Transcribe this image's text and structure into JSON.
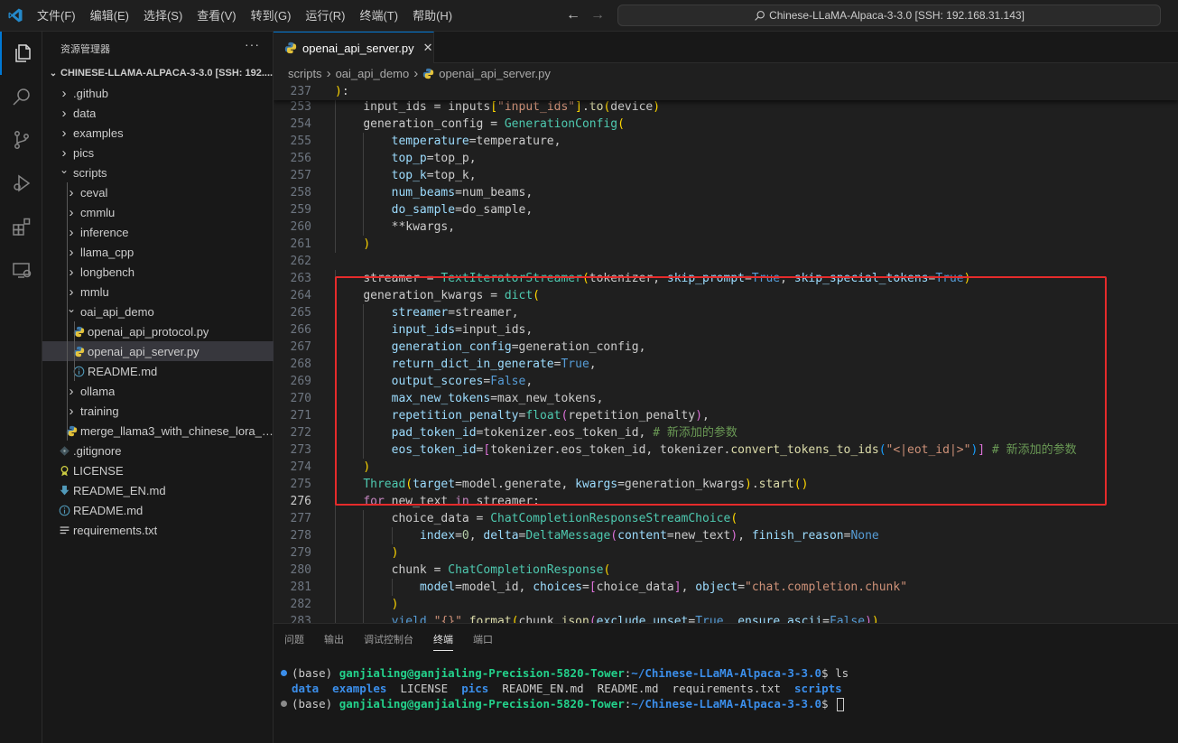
{
  "titlebar": {
    "menus": [
      "文件(F)",
      "编辑(E)",
      "选择(S)",
      "查看(V)",
      "转到(G)",
      "运行(R)",
      "终端(T)",
      "帮助(H)"
    ],
    "command_center": "Chinese-LLaMA-Alpaca-3-3.0 [SSH: 192.168.31.143]"
  },
  "sidebar": {
    "title": "资源管理器",
    "more": "···",
    "root": "CHINESE-LLAMA-ALPACA-3-3.0 [SSH: 192....",
    "items": [
      {
        "label": ".github",
        "type": "folder",
        "depth": 0,
        "expanded": false
      },
      {
        "label": "data",
        "type": "folder",
        "depth": 0,
        "expanded": false
      },
      {
        "label": "examples",
        "type": "folder",
        "depth": 0,
        "expanded": false
      },
      {
        "label": "pics",
        "type": "folder",
        "depth": 0,
        "expanded": false
      },
      {
        "label": "scripts",
        "type": "folder",
        "depth": 0,
        "expanded": true
      },
      {
        "label": "ceval",
        "type": "folder",
        "depth": 1,
        "expanded": false
      },
      {
        "label": "cmmlu",
        "type": "folder",
        "depth": 1,
        "expanded": false
      },
      {
        "label": "inference",
        "type": "folder",
        "depth": 1,
        "expanded": false
      },
      {
        "label": "llama_cpp",
        "type": "folder",
        "depth": 1,
        "expanded": false
      },
      {
        "label": "longbench",
        "type": "folder",
        "depth": 1,
        "expanded": false
      },
      {
        "label": "mmlu",
        "type": "folder",
        "depth": 1,
        "expanded": false
      },
      {
        "label": "oai_api_demo",
        "type": "folder",
        "depth": 1,
        "expanded": true
      },
      {
        "label": "openai_api_protocol.py",
        "type": "python",
        "depth": 2
      },
      {
        "label": "openai_api_server.py",
        "type": "python",
        "depth": 2,
        "selected": true
      },
      {
        "label": "README.md",
        "type": "info",
        "depth": 2
      },
      {
        "label": "ollama",
        "type": "folder",
        "depth": 1,
        "expanded": false
      },
      {
        "label": "training",
        "type": "folder",
        "depth": 1,
        "expanded": false
      },
      {
        "label": "merge_llama3_with_chinese_lora_lo...",
        "type": "python",
        "depth": 1
      },
      {
        "label": ".gitignore",
        "type": "git",
        "depth": 0
      },
      {
        "label": "LICENSE",
        "type": "license",
        "depth": 0
      },
      {
        "label": "README_EN.md",
        "type": "download",
        "depth": 0
      },
      {
        "label": "README.md",
        "type": "info",
        "depth": 0
      },
      {
        "label": "requirements.txt",
        "type": "text",
        "depth": 0
      }
    ]
  },
  "editor": {
    "tab_label": "openai_api_server.py",
    "tab_close": "✕",
    "breadcrumb": [
      "scripts",
      "oai_api_demo",
      "openai_api_server.py"
    ],
    "current_line": "276",
    "sticky_line": {
      "num": "237",
      "tokens": [
        [
          "b",
          ")"
        ],
        [
          "p",
          ":"
        ]
      ]
    },
    "lines": [
      {
        "num": "253",
        "indent": 1,
        "tokens": [
          [
            "p",
            "input_ids = inputs"
          ],
          [
            "b",
            "["
          ],
          [
            "s",
            "\"input_ids\""
          ],
          [
            "b",
            "]"
          ],
          [
            "p",
            "."
          ],
          [
            "f",
            "to"
          ],
          [
            "b",
            "("
          ],
          [
            "p",
            "device"
          ],
          [
            "b",
            ")"
          ]
        ]
      },
      {
        "num": "254",
        "indent": 1,
        "tokens": [
          [
            "p",
            "generation_config = "
          ],
          [
            "c",
            "GenerationConfig"
          ],
          [
            "b",
            "("
          ]
        ]
      },
      {
        "num": "255",
        "indent": 2,
        "tokens": [
          [
            "v",
            "temperature"
          ],
          [
            "p",
            "=temperature,"
          ]
        ]
      },
      {
        "num": "256",
        "indent": 2,
        "tokens": [
          [
            "v",
            "top_p"
          ],
          [
            "p",
            "=top_p,"
          ]
        ]
      },
      {
        "num": "257",
        "indent": 2,
        "tokens": [
          [
            "v",
            "top_k"
          ],
          [
            "p",
            "=top_k,"
          ]
        ]
      },
      {
        "num": "258",
        "indent": 2,
        "tokens": [
          [
            "v",
            "num_beams"
          ],
          [
            "p",
            "=num_beams,"
          ]
        ]
      },
      {
        "num": "259",
        "indent": 2,
        "tokens": [
          [
            "v",
            "do_sample"
          ],
          [
            "p",
            "=do_sample,"
          ]
        ]
      },
      {
        "num": "260",
        "indent": 2,
        "tokens": [
          [
            "p",
            "**kwargs,"
          ]
        ]
      },
      {
        "num": "261",
        "indent": 1,
        "tokens": [
          [
            "b",
            ")"
          ]
        ]
      },
      {
        "num": "262",
        "indent": 0,
        "tokens": []
      },
      {
        "num": "263",
        "indent": 1,
        "tokens": [
          [
            "p",
            "streamer = "
          ],
          [
            "c",
            "TextIteratorStreamer"
          ],
          [
            "b",
            "("
          ],
          [
            "p",
            "tokenizer, "
          ],
          [
            "v",
            "skip_prompt"
          ],
          [
            "p",
            "="
          ],
          [
            "k",
            "True"
          ],
          [
            "p",
            ", "
          ],
          [
            "v",
            "skip_special_tokens"
          ],
          [
            "p",
            "="
          ],
          [
            "k",
            "True"
          ],
          [
            "b",
            ")"
          ]
        ]
      },
      {
        "num": "264",
        "indent": 1,
        "tokens": [
          [
            "p",
            "generation_kwargs = "
          ],
          [
            "c",
            "dict"
          ],
          [
            "b",
            "("
          ]
        ]
      },
      {
        "num": "265",
        "indent": 2,
        "tokens": [
          [
            "v",
            "streamer"
          ],
          [
            "p",
            "=streamer,"
          ]
        ]
      },
      {
        "num": "266",
        "indent": 2,
        "tokens": [
          [
            "v",
            "input_ids"
          ],
          [
            "p",
            "=input_ids,"
          ]
        ]
      },
      {
        "num": "267",
        "indent": 2,
        "tokens": [
          [
            "v",
            "generation_config"
          ],
          [
            "p",
            "=generation_config,"
          ]
        ]
      },
      {
        "num": "268",
        "indent": 2,
        "tokens": [
          [
            "v",
            "return_dict_in_generate"
          ],
          [
            "p",
            "="
          ],
          [
            "k",
            "True"
          ],
          [
            "p",
            ","
          ]
        ]
      },
      {
        "num": "269",
        "indent": 2,
        "tokens": [
          [
            "v",
            "output_scores"
          ],
          [
            "p",
            "="
          ],
          [
            "k",
            "False"
          ],
          [
            "p",
            ","
          ]
        ]
      },
      {
        "num": "270",
        "indent": 2,
        "tokens": [
          [
            "v",
            "max_new_tokens"
          ],
          [
            "p",
            "=max_new_tokens,"
          ]
        ]
      },
      {
        "num": "271",
        "indent": 2,
        "tokens": [
          [
            "v",
            "repetition_penalty"
          ],
          [
            "p",
            "="
          ],
          [
            "c",
            "float"
          ],
          [
            "b2",
            "("
          ],
          [
            "p",
            "repetition_penalty"
          ],
          [
            "b2",
            ")"
          ],
          [
            "p",
            ","
          ]
        ]
      },
      {
        "num": "272",
        "indent": 2,
        "tokens": [
          [
            "v",
            "pad_token_id"
          ],
          [
            "p",
            "=tokenizer.eos_token_id, "
          ],
          [
            "cm",
            "# 新添加的参数"
          ]
        ]
      },
      {
        "num": "273",
        "indent": 2,
        "tokens": [
          [
            "v",
            "eos_token_id"
          ],
          [
            "p",
            "="
          ],
          [
            "b2",
            "["
          ],
          [
            "p",
            "tokenizer.eos_token_id, tokenizer."
          ],
          [
            "f",
            "convert_tokens_to_ids"
          ],
          [
            "b3",
            "("
          ],
          [
            "s",
            "\"<|eot_id|>\""
          ],
          [
            "b3",
            ")"
          ],
          [
            "b2",
            "]"
          ],
          [
            "p",
            " "
          ],
          [
            "cm",
            "# 新添加的参数"
          ]
        ]
      },
      {
        "num": "274",
        "indent": 1,
        "tokens": [
          [
            "b",
            ")"
          ]
        ]
      },
      {
        "num": "275",
        "indent": 1,
        "tokens": [
          [
            "c",
            "Thread"
          ],
          [
            "b",
            "("
          ],
          [
            "v",
            "target"
          ],
          [
            "p",
            "=model.generate, "
          ],
          [
            "v",
            "kwargs"
          ],
          [
            "p",
            "=generation_kwargs"
          ],
          [
            "b",
            ")"
          ],
          [
            "p",
            "."
          ],
          [
            "f",
            "start"
          ],
          [
            "b",
            "()"
          ]
        ]
      },
      {
        "num": "276",
        "indent": 1,
        "tokens": [
          [
            "k2",
            "for"
          ],
          [
            "p",
            " new_text "
          ],
          [
            "k2",
            "in"
          ],
          [
            "p",
            " streamer:"
          ]
        ]
      },
      {
        "num": "277",
        "indent": 2,
        "tokens": [
          [
            "p",
            "choice_data = "
          ],
          [
            "c",
            "ChatCompletionResponseStreamChoice"
          ],
          [
            "b",
            "("
          ]
        ]
      },
      {
        "num": "278",
        "indent": 3,
        "tokens": [
          [
            "v",
            "index"
          ],
          [
            "p",
            "="
          ],
          [
            "n",
            "0"
          ],
          [
            "p",
            ", "
          ],
          [
            "v",
            "delta"
          ],
          [
            "p",
            "="
          ],
          [
            "c",
            "DeltaMessage"
          ],
          [
            "b2",
            "("
          ],
          [
            "v",
            "content"
          ],
          [
            "p",
            "=new_text"
          ],
          [
            "b2",
            ")"
          ],
          [
            "p",
            ", "
          ],
          [
            "v",
            "finish_reason"
          ],
          [
            "p",
            "="
          ],
          [
            "k",
            "None"
          ]
        ]
      },
      {
        "num": "279",
        "indent": 2,
        "tokens": [
          [
            "b",
            ")"
          ]
        ]
      },
      {
        "num": "280",
        "indent": 2,
        "tokens": [
          [
            "p",
            "chunk = "
          ],
          [
            "c",
            "ChatCompletionResponse"
          ],
          [
            "b",
            "("
          ]
        ]
      },
      {
        "num": "281",
        "indent": 3,
        "tokens": [
          [
            "v",
            "model"
          ],
          [
            "p",
            "=model_id, "
          ],
          [
            "v",
            "choices"
          ],
          [
            "p",
            "="
          ],
          [
            "b2",
            "["
          ],
          [
            "p",
            "choice_data"
          ],
          [
            "b2",
            "]"
          ],
          [
            "p",
            ", "
          ],
          [
            "v",
            "object"
          ],
          [
            "p",
            "="
          ],
          [
            "s",
            "\"chat.completion.chunk\""
          ]
        ]
      },
      {
        "num": "282",
        "indent": 2,
        "tokens": [
          [
            "b",
            ")"
          ]
        ]
      },
      {
        "num": "283",
        "indent": 2,
        "tokens": [
          [
            "k",
            "yield"
          ],
          [
            "p",
            " "
          ],
          [
            "s",
            "\"{}\""
          ],
          [
            "p",
            "."
          ],
          [
            "f",
            "format"
          ],
          [
            "b",
            "("
          ],
          [
            "p",
            "chunk."
          ],
          [
            "f",
            "json"
          ],
          [
            "b2",
            "("
          ],
          [
            "v",
            "exclude_unset"
          ],
          [
            "p",
            "="
          ],
          [
            "k",
            "True"
          ],
          [
            "p",
            ", "
          ],
          [
            "v",
            "ensure_ascii"
          ],
          [
            "p",
            "="
          ],
          [
            "k",
            "False"
          ],
          [
            "b2",
            ")"
          ],
          [
            "b",
            ")"
          ]
        ]
      }
    ]
  },
  "panel": {
    "tabs": [
      "问题",
      "输出",
      "调试控制台",
      "终端",
      "端口"
    ],
    "active_tab": "终端",
    "terminal": {
      "prompt_env": "(base) ",
      "user_host": "ganjialing@ganjialing-Precision-5820-Tower",
      "path": "~/Chinese-LLaMA-Alpaca-3-3.0",
      "command": "ls",
      "ls_output": [
        {
          "name": "data",
          "dir": true
        },
        {
          "name": "examples",
          "dir": true
        },
        {
          "name": "LICENSE",
          "dir": false
        },
        {
          "name": "pics",
          "dir": true
        },
        {
          "name": "README_EN.md",
          "dir": false
        },
        {
          "name": "README.md",
          "dir": false
        },
        {
          "name": "requirements.txt",
          "dir": false
        },
        {
          "name": "scripts",
          "dir": true
        }
      ],
      "dot_colors": [
        "#3b8eea",
        "#8a8a8a"
      ]
    }
  },
  "colors": {
    "accent": "#0078d4",
    "highlight_box": "#e52b2b"
  }
}
